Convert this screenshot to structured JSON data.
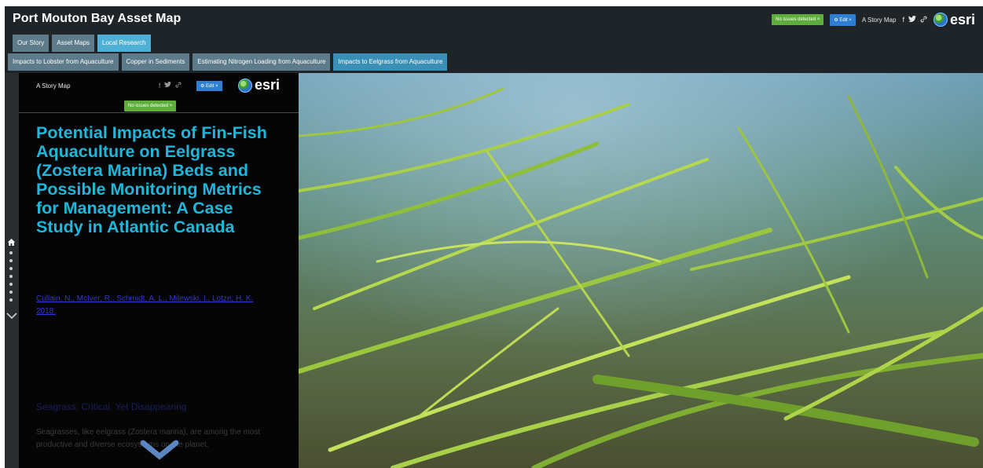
{
  "app": {
    "title": "Port Mouton Bay Asset Map"
  },
  "header": {
    "issues_badge": "No issues detected ×",
    "edit_button": "⚙ Edit ×",
    "storymap_link": "A Story Map",
    "logo_text": "esri"
  },
  "tabs_primary": [
    {
      "label": "Our Story",
      "active": false
    },
    {
      "label": "Asset Maps",
      "active": false
    },
    {
      "label": "Local Research",
      "active": true
    }
  ],
  "tabs_secondary": [
    {
      "label": "Impacts to Lobster from Aquaculture",
      "active": false
    },
    {
      "label": "Copper in Sediments",
      "active": false
    },
    {
      "label": "Estimating Nitrogen Loading from Aquaculture",
      "active": false
    },
    {
      "label": "Impacts to Eelgrass from Aquaculture",
      "active": true
    }
  ],
  "side_panel": {
    "storymap_label": "A Story Map",
    "edit_button": "⚙ Edit ×",
    "logo_text": "esri",
    "issues_badge": "No issues detected ×",
    "title": "Potential Impacts of Fin-Fish Aquaculture on Eelgrass (Zostera Marina) Beds and Possible Monitoring Metrics for Management: A Case Study in Atlantic Canada",
    "authors": "Cullain, N., McIver, R., Schmidt, A. L., Milewski, I., Lotze, H. K. 2018.",
    "section_heading": "Seagrass: Critical, Yet Disappearing",
    "body_text": "Seagrasses, like eelgrass (Zostera marina), are among the most productive and diverse ecosystems on the planet."
  },
  "icons": {
    "facebook": "f",
    "twitter": "🐦",
    "link": "🔗",
    "home": "⌂",
    "chevron_down": "⌄"
  },
  "colors": {
    "title_cyan": "#1fb6dc",
    "tab_active": "#4eb0d4",
    "tab_inactive": "#5d7b8a",
    "badge_green": "#5fae3c",
    "edit_blue": "#2d7fd4"
  }
}
